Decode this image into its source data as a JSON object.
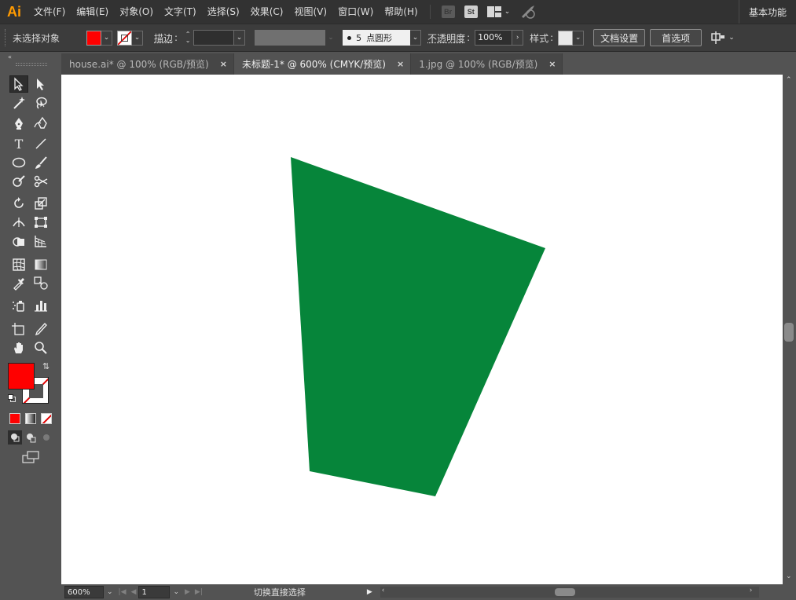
{
  "app": {
    "logo": "Ai",
    "workspace": "基本功能"
  },
  "menu": [
    "文件(F)",
    "编辑(E)",
    "对象(O)",
    "文字(T)",
    "选择(S)",
    "效果(C)",
    "视图(V)",
    "窗口(W)",
    "帮助(H)"
  ],
  "bridge_badges": {
    "br": "Br",
    "st": "St"
  },
  "control": {
    "selection_status": "未选择对象",
    "fill_color": "#ff0000",
    "stroke_label": "描边",
    "brush_size": "5",
    "brush_profile": "点圆形",
    "opacity_label": "不透明度",
    "opacity_value": "100%",
    "style_label": "样式",
    "doc_setup_button": "文档设置",
    "preferences_button": "首选项"
  },
  "tabs": [
    {
      "label": "house.ai* @ 100% (RGB/预览)",
      "active": false
    },
    {
      "label": "未标题-1* @ 600% (CMYK/预览)",
      "active": true
    },
    {
      "label": "1.jpg @ 100% (RGB/预览)",
      "active": false
    }
  ],
  "toolbar": {
    "fill_color": "#ff0000",
    "stroke": "none",
    "tools": [
      [
        "selection-tool",
        "direct-selection-tool"
      ],
      [
        "magic-wand-tool",
        "lasso-tool"
      ],
      [
        "pen-tool",
        "curvature-tool"
      ],
      [
        "type-tool",
        "line-segment-tool"
      ],
      [
        "ellipse-tool",
        "paintbrush-tool"
      ],
      [
        "shaper-tool",
        "scissors-tool"
      ],
      [
        "rotate-tool",
        "scale-tool"
      ],
      [
        "width-tool",
        "free-transform-tool"
      ],
      [
        "shape-builder-tool",
        "perspective-grid-tool"
      ],
      [
        "mesh-tool",
        "gradient-tool"
      ],
      [
        "eyedropper-tool",
        "blend-tool"
      ],
      [
        "symbol-sprayer-tool",
        "column-graph-tool"
      ],
      [
        "artboard-tool",
        "slice-tool"
      ],
      [
        "hand-tool",
        "zoom-tool"
      ]
    ]
  },
  "artwork": {
    "shape": "quadrilateral",
    "fill": "#06853a"
  },
  "status": {
    "zoom": "600%",
    "artboard_number": "1",
    "hint": "切换直接选择"
  }
}
